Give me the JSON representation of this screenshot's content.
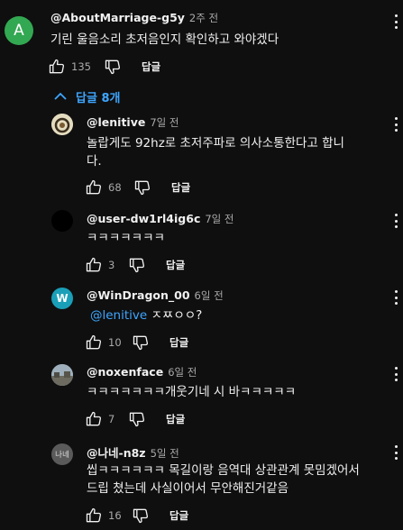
{
  "top_comment": {
    "avatar_letter": "A",
    "avatar_color": "#33a852",
    "author": "@AboutMarriage-g5y",
    "time": "2주 전",
    "text": "기린 울음소리 초저음인지 확인하고 와야겠다",
    "likes": "135",
    "reply_label": "답글"
  },
  "replies_toggle": {
    "label": "답글 8개",
    "icon": "chevron-up-icon",
    "color": "#3ea6ff"
  },
  "replies": [
    {
      "author": "@lenitive",
      "time": "7일 전",
      "text": "놀랍게도 92hz로 초저주파로 의사소통한다고 합니다.",
      "likes": "68",
      "reply_label": "답글",
      "avatar_style": "photo-ring"
    },
    {
      "author": "@user-dw1rl4ig6c",
      "time": "7일 전",
      "text": "ㅋㅋㅋㅋㅋㅋㅋ",
      "likes": "3",
      "reply_label": "답글",
      "avatar_style": "black"
    },
    {
      "author": "@WinDragon_00",
      "time": "6일 전",
      "mention": "@lenitive",
      "text": " ㅈㅉㅇㅇ?",
      "likes": "10",
      "reply_label": "답글",
      "avatar_letter": "W",
      "avatar_color": "#1a9fb8"
    },
    {
      "author": "@noxenface",
      "time": "6일 전",
      "text": "ㅋㅋㅋㅋㅋㅋㅋ개웃기네 시 바ㅋㅋㅋㅋㅋ",
      "likes": "7",
      "reply_label": "답글",
      "avatar_style": "photo-scenery"
    },
    {
      "author": "@나네-n8z",
      "time": "5일 전",
      "avatar_letter": "나네",
      "text": "씹ㅋㅋㅋㅋㅋㅋ 목길이랑 음역대 상관관계 못밈겠어서 드립 쳤는데 사실이어서 무안해진거같음",
      "likes": "16",
      "reply_label": "답글",
      "avatar_color": "#5a5a5a"
    }
  ],
  "icons": {
    "like": "thumbs-up-icon",
    "dislike": "thumbs-down-icon",
    "more": "more-vert-icon"
  }
}
